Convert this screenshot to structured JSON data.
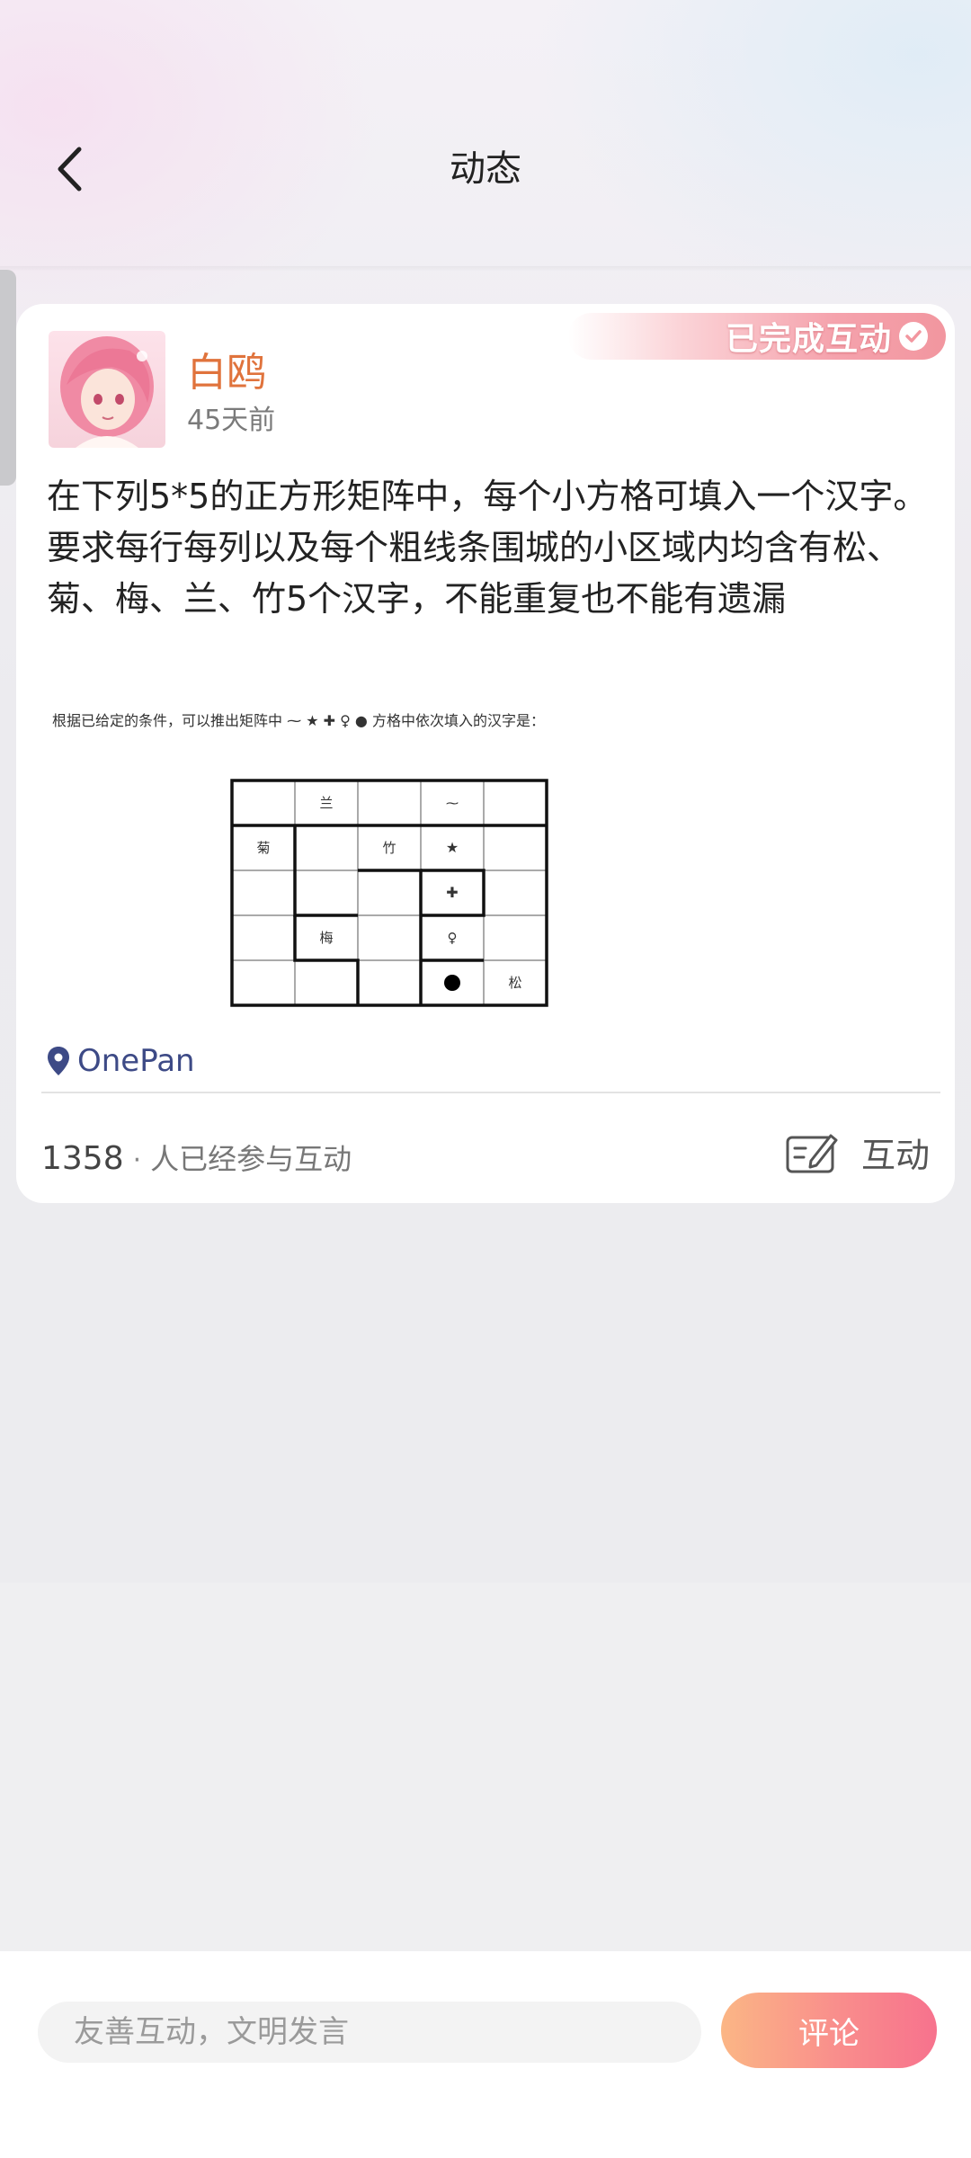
{
  "header": {
    "title": "动态"
  },
  "post": {
    "badge": "已完成互动",
    "author": "白鸥",
    "time": "45天前",
    "text": "在下列5*5的正方形矩阵中，每个小方格可填入一个汉字。要求每行每列以及每个粗线条围城的小区域内均含有松、菊、梅、兰、竹5个汉字，不能重复也不能有遗漏",
    "image": {
      "caption": "根据已给定的条件，可以推出矩阵中",
      "caption_tail": "方格中依次填入的汉字是：",
      "grid": [
        [
          "",
          "兰",
          "",
          "",
          ""
        ],
        [
          "菊",
          "",
          "竹",
          "",
          ""
        ],
        [
          "",
          "",
          "",
          "",
          ""
        ],
        [
          "",
          "梅",
          "",
          "",
          ""
        ],
        [
          "",
          "",
          "",
          "",
          "松"
        ]
      ]
    },
    "location": "OnePan",
    "participants_count": "1358",
    "participants_dot": "·",
    "participants_label": "人已经参与互动",
    "interact_label": "互动"
  },
  "footer": {
    "input_placeholder": "友善互动，文明发言",
    "submit_label": "评论"
  },
  "colors": {
    "username": "#e0733c",
    "location": "#3d4a86",
    "comment_button_start": "#fbb685",
    "comment_button_end": "#f7728d"
  },
  "icons": {
    "back": "chevron-left-icon",
    "badge_check": "check-circle-icon",
    "location": "map-pin-icon",
    "interact": "edit-note-icon"
  }
}
